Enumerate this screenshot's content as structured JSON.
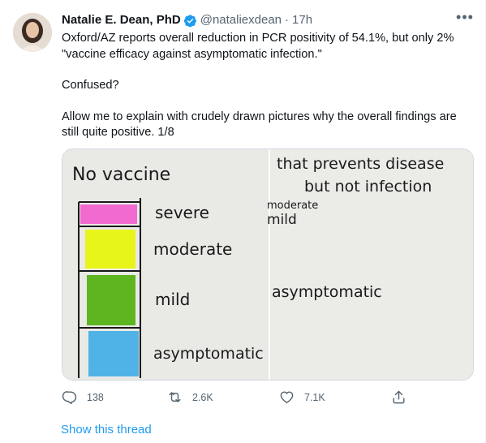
{
  "tweet": {
    "author_name": "Natalie E. Dean, PhD",
    "handle": "@nataliexdean",
    "separator": "·",
    "time": "17h",
    "paragraphs": [
      "Oxford/AZ reports overall reduction in PCR positivity of 54.1%, but only 2% \"vaccine efficacy against asymptomatic infection.\"",
      "Confused?",
      "Allow me to explain with crudely drawn pictures why the overall findings are still quite positive. 1/8"
    ]
  },
  "image": {
    "left_panel": {
      "title": "No vaccine",
      "labels": [
        "severe",
        "moderate",
        "mild",
        "asymptomatic"
      ],
      "colors": [
        "#f06ad0",
        "#e8f51a",
        "#5db51f",
        "#4fb3e8"
      ]
    },
    "right_panel": {
      "title_line1": "that prevents disease",
      "title_line2": "but not infection",
      "label_moderate": "moderate",
      "label_mild": "mild",
      "label_asymptomatic": "asymptomatic"
    }
  },
  "actions": {
    "replies": "138",
    "retweets": "2.6K",
    "likes": "7.1K"
  },
  "show_thread": "Show this thread",
  "colors": {
    "accent": "#1d9bf0",
    "muted": "#536471"
  }
}
